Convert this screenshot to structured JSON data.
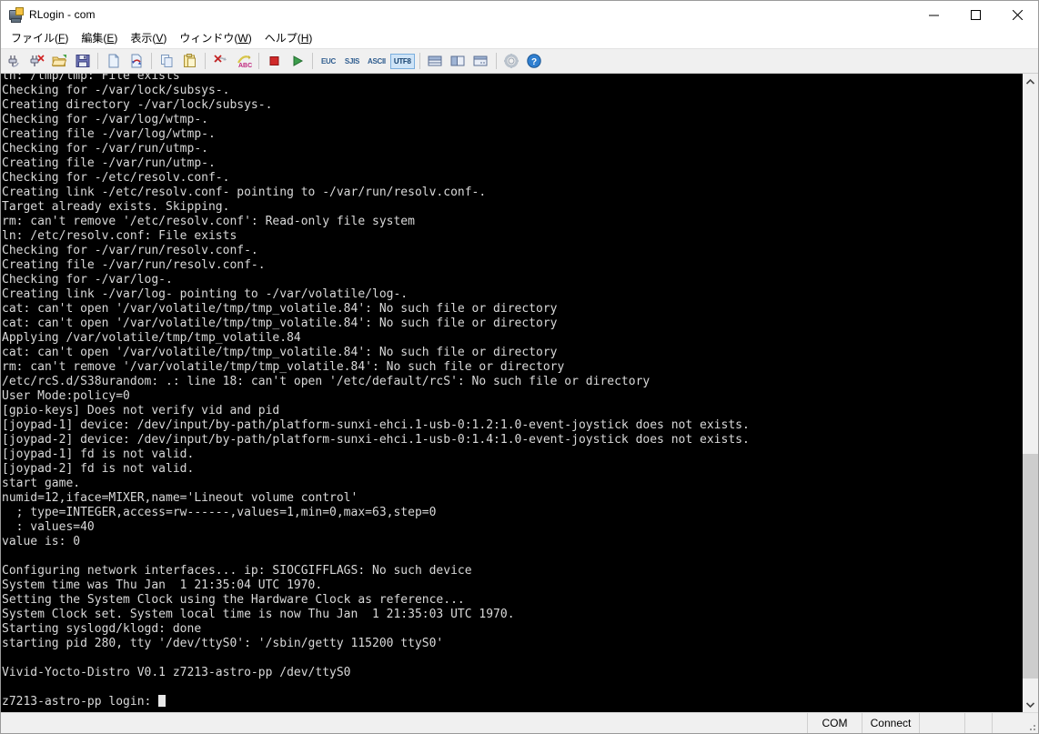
{
  "window": {
    "title": "RLogin - com",
    "app_icon": "terminal-window-icon",
    "controls": {
      "minimize": "minimize-icon",
      "maximize": "maximize-icon",
      "close": "close-icon"
    }
  },
  "menubar": {
    "items": [
      {
        "label_pre": "ファイル(",
        "mnemonic": "F",
        "label_post": ")",
        "name": "menu-file"
      },
      {
        "label_pre": "編集(",
        "mnemonic": "E",
        "label_post": ")",
        "name": "menu-edit"
      },
      {
        "label_pre": "表示(",
        "mnemonic": "V",
        "label_post": ")",
        "name": "menu-view"
      },
      {
        "label_pre": "ウィンドウ(",
        "mnemonic": "W",
        "label_post": ")",
        "name": "menu-window"
      },
      {
        "label_pre": "ヘルプ(",
        "mnemonic": "H",
        "label_post": ")",
        "name": "menu-help"
      }
    ]
  },
  "toolbar": {
    "icons": [
      "connect-icon",
      "disconnect-icon",
      "open-folder-icon",
      "save-icon",
      "new-file-icon",
      "reload-icon",
      "copy-icon",
      "paste-icon",
      "clear-screen-icon",
      "abc-macro-icon",
      "stop-icon",
      "run-icon"
    ],
    "encodings": [
      {
        "label": "EUC",
        "selected": false
      },
      {
        "label": "SJIS",
        "selected": false
      },
      {
        "label": "ASCII",
        "selected": false
      },
      {
        "label": "UTF8",
        "selected": true
      }
    ],
    "view_icons": [
      "split-horizontal-icon",
      "split-vertical-icon",
      "pane-layout-icon",
      "settings-gear-icon",
      "help-icon"
    ]
  },
  "terminal": {
    "prompt_text": "z7213-astro-pp login: ",
    "cursor": "block-cursor",
    "lines": [
      "ln: /tmp/tmp: File exists",
      "Checking for -/var/lock/subsys-.",
      "Creating directory -/var/lock/subsys-.",
      "Checking for -/var/log/wtmp-.",
      "Creating file -/var/log/wtmp-.",
      "Checking for -/var/run/utmp-.",
      "Creating file -/var/run/utmp-.",
      "Checking for -/etc/resolv.conf-.",
      "Creating link -/etc/resolv.conf- pointing to -/var/run/resolv.conf-.",
      "Target already exists. Skipping.",
      "rm: can't remove '/etc/resolv.conf': Read-only file system",
      "ln: /etc/resolv.conf: File exists",
      "Checking for -/var/run/resolv.conf-.",
      "Creating file -/var/run/resolv.conf-.",
      "Checking for -/var/log-.",
      "Creating link -/var/log- pointing to -/var/volatile/log-.",
      "cat: can't open '/var/volatile/tmp/tmp_volatile.84': No such file or directory",
      "cat: can't open '/var/volatile/tmp/tmp_volatile.84': No such file or directory",
      "Applying /var/volatile/tmp/tmp_volatile.84",
      "cat: can't open '/var/volatile/tmp/tmp_volatile.84': No such file or directory",
      "rm: can't remove '/var/volatile/tmp/tmp_volatile.84': No such file or directory",
      "/etc/rcS.d/S38urandom: .: line 18: can't open '/etc/default/rcS': No such file or directory",
      "User Mode:policy=0",
      "[gpio-keys] Does not verify vid and pid",
      "[joypad-1] device: /dev/input/by-path/platform-sunxi-ehci.1-usb-0:1.2:1.0-event-joystick does not exists.",
      "[joypad-2] device: /dev/input/by-path/platform-sunxi-ehci.1-usb-0:1.4:1.0-event-joystick does not exists.",
      "[joypad-1] fd is not valid.",
      "[joypad-2] fd is not valid.",
      "start game.",
      "numid=12,iface=MIXER,name='Lineout volume control'",
      "  ; type=INTEGER,access=rw------,values=1,min=0,max=63,step=0",
      "  : values=40",
      "value is: 0",
      "",
      "Configuring network interfaces... ip: SIOCGIFFLAGS: No such device",
      "System time was Thu Jan  1 21:35:04 UTC 1970.",
      "Setting the System Clock using the Hardware Clock as reference...",
      "System Clock set. System local time is now Thu Jan  1 21:35:03 UTC 1970.",
      "Starting syslogd/klogd: done",
      "starting pid 280, tty '/dev/ttyS0': '/sbin/getty 115200 ttyS0'",
      "",
      "Vivid-Yocto-Distro V0.1 z7213-astro-pp /dev/ttyS0",
      ""
    ]
  },
  "scrollbar": {
    "up_arrow": "scroll-up-icon",
    "down_arrow": "scroll-down-icon",
    "thumb_top_pct": 60,
    "thumb_height_pct": 37
  },
  "statusbar": {
    "com": "COM",
    "connect": "Connect",
    "blank1": "",
    "blank2": "",
    "blank3": ""
  },
  "colors": {
    "terminal_bg": "#000000",
    "terminal_fg": "#d9d9d9",
    "chrome_bg": "#f0f0f0",
    "accent_selected": "#cfe4f7"
  }
}
